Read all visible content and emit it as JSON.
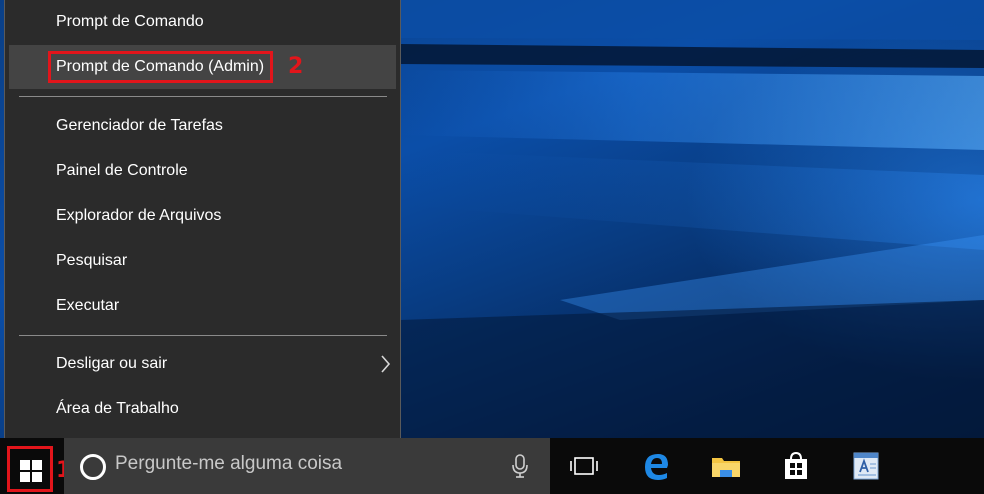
{
  "menu": {
    "items": [
      {
        "label": "Prompt de Comando"
      },
      {
        "label": "Prompt de Comando (Admin)"
      },
      {
        "label": "Gerenciador de Tarefas"
      },
      {
        "label": "Painel de Controle"
      },
      {
        "label": "Explorador de Arquivos"
      },
      {
        "label": "Pesquisar"
      },
      {
        "label": "Executar"
      },
      {
        "label": "Desligar ou sair"
      },
      {
        "label": "Área de Trabalho"
      }
    ]
  },
  "annotations": {
    "start_marker": "1",
    "admin_marker": "2",
    "color": "#e2151b"
  },
  "taskbar": {
    "search_placeholder": "Pergunte-me alguma coisa",
    "icons": [
      "windows-logo-icon",
      "cortana-icon",
      "microphone-icon",
      "task-view-icon",
      "edge-icon",
      "file-explorer-icon",
      "store-icon",
      "wordpad-icon"
    ]
  }
}
